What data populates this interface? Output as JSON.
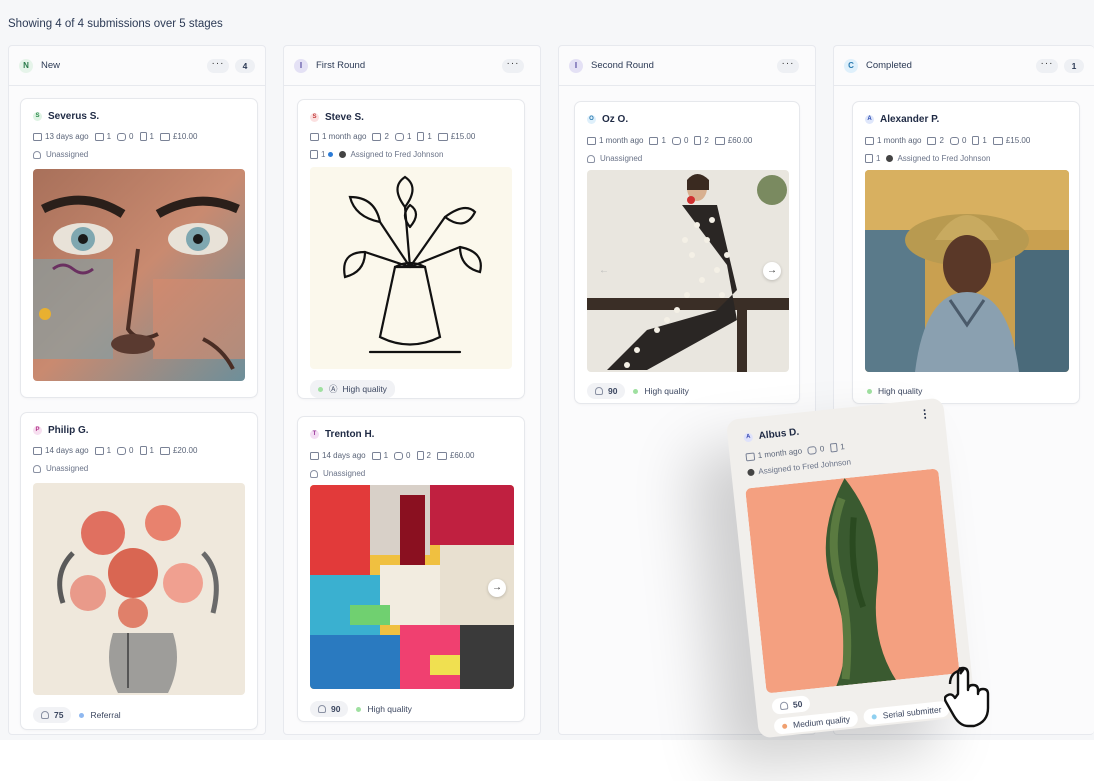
{
  "summary": "Showing 4 of 4 submissions over 5 stages",
  "columns": [
    {
      "badge": "N",
      "title": "New",
      "count": "4",
      "badge_color": "#e6f4ea",
      "badge_text": "#2a7a4a"
    },
    {
      "badge": "I",
      "title": "First Round",
      "count": "",
      "badge_color": "#e4e1f5",
      "badge_text": "#5a4fa3"
    },
    {
      "badge": "I",
      "title": "Second Round",
      "count": "",
      "badge_color": "#e4e1f5",
      "badge_text": "#5a4fa3"
    },
    {
      "badge": "C",
      "title": "Completed",
      "count": "1",
      "badge_color": "#dff0fb",
      "badge_text": "#2a7ab0"
    }
  ],
  "cards": {
    "severus": {
      "initial": "S",
      "name": "Severus S.",
      "age": "13 days ago",
      "mail": "1",
      "comments": "0",
      "files": "1",
      "price": "£10.00",
      "assignee": "Unassigned"
    },
    "philip": {
      "initial": "P",
      "name": "Philip G.",
      "age": "14 days ago",
      "mail": "1",
      "comments": "0",
      "files": "1",
      "price": "£20.00",
      "assignee": "Unassigned",
      "score": "75",
      "tag": "Referral"
    },
    "steve": {
      "initial": "S",
      "name": "Steve S.",
      "age": "1 month ago",
      "mail": "2",
      "comments": "1",
      "files": "1",
      "price": "£15.00",
      "tasks": "1",
      "assignee": "Assigned to Fred Johnson",
      "tag": "High quality"
    },
    "trenton": {
      "initial": "T",
      "name": "Trenton H.",
      "age": "14 days ago",
      "mail": "1",
      "comments": "0",
      "files": "2",
      "price": "£60.00",
      "assignee": "Unassigned",
      "score": "90",
      "tag": "High quality"
    },
    "oz": {
      "initial": "O",
      "name": "Oz O.",
      "age": "1 month ago",
      "mail": "1",
      "comments": "0",
      "files": "2",
      "price": "£60.00",
      "assignee": "Unassigned",
      "score": "90",
      "tag": "High quality"
    },
    "alexander": {
      "initial": "A",
      "name": "Alexander P.",
      "age": "1 month ago",
      "mail": "2",
      "comments": "0",
      "files": "1",
      "price": "£15.00",
      "tasks": "1",
      "assignee": "Assigned to Fred Johnson",
      "tag": "High quality"
    },
    "albus": {
      "initial": "A",
      "name": "Albus D.",
      "age": "1 month ago",
      "comments": "0",
      "files": "1",
      "assignee": "Assigned to Fred Johnson",
      "score": "50",
      "tag1": "Medium quality",
      "tag2": "Serial submitter"
    }
  },
  "icons": {
    "calendar": "calendar-icon",
    "mail": "mail-icon",
    "comment": "comment-icon",
    "file": "file-icon",
    "wallet": "wallet-icon",
    "person": "person-icon"
  }
}
